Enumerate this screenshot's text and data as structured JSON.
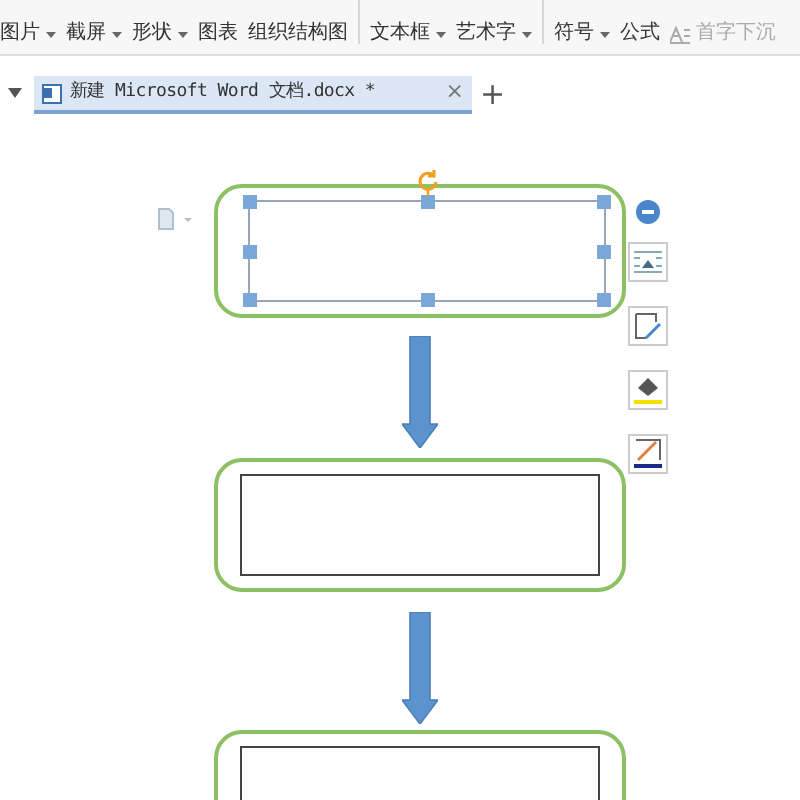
{
  "toolbar": {
    "items": [
      {
        "label": "图片",
        "dropdown": true,
        "disabled": false
      },
      {
        "label": "截屏",
        "dropdown": true,
        "disabled": false
      },
      {
        "label": "形状",
        "dropdown": true,
        "disabled": false
      },
      {
        "label": "图表",
        "dropdown": false,
        "disabled": false
      },
      {
        "label": "组织结构图",
        "dropdown": false,
        "disabled": false
      },
      {
        "label": "文本框",
        "dropdown": true,
        "disabled": false,
        "group_start": true
      },
      {
        "label": "艺术字",
        "dropdown": true,
        "disabled": false
      },
      {
        "label": "符号",
        "dropdown": true,
        "disabled": false,
        "group_start": true
      },
      {
        "label": "公式",
        "dropdown": false,
        "disabled": false
      },
      {
        "label": "首字下沉",
        "dropdown": false,
        "disabled": true
      }
    ]
  },
  "tabs": [
    {
      "title": "新建 Microsoft Word 文档.docx *",
      "close": "×",
      "selected": true
    }
  ],
  "new_tab": "+",
  "flowchart": {
    "nodes": [
      {
        "selected": true
      },
      {
        "selected": false
      },
      {
        "selected": false
      }
    ]
  }
}
